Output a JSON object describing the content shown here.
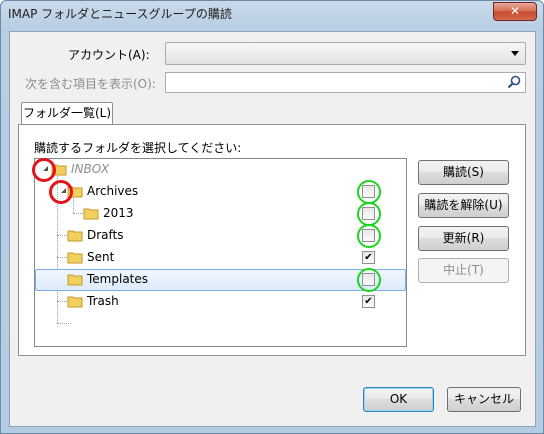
{
  "window": {
    "title": "IMAP フォルダとニュースグループの購読",
    "close_label": "✕"
  },
  "account": {
    "label": "アカウント(A):",
    "value": ""
  },
  "filter": {
    "label": "次を含む項目を表示(O):",
    "value": ""
  },
  "tabs": [
    {
      "label": "フォルダ一覧(L)"
    }
  ],
  "instruction": "購読するフォルダを選択してください:",
  "folders": [
    {
      "name": "INBOX",
      "level": 0,
      "subscribed": null,
      "disabled": true
    },
    {
      "name": "Archives",
      "level": 1,
      "subscribed": false,
      "disabled": false
    },
    {
      "name": "2013",
      "level": 2,
      "subscribed": false,
      "disabled": false
    },
    {
      "name": "Drafts",
      "level": 1,
      "subscribed": false,
      "disabled": false
    },
    {
      "name": "Sent",
      "level": 1,
      "subscribed": true,
      "disabled": false
    },
    {
      "name": "Templates",
      "level": 1,
      "subscribed": false,
      "disabled": false,
      "selected": true
    },
    {
      "name": "Trash",
      "level": 1,
      "subscribed": true,
      "disabled": false
    }
  ],
  "side_buttons": {
    "subscribe": "購読(S)",
    "unsubscribe": "購読を解除(U)",
    "refresh": "更新(R)",
    "stop": "中止(T)"
  },
  "footer": {
    "ok": "OK",
    "cancel": "キャンセル"
  },
  "check_mark": "✔",
  "colors": {
    "annotation_green": "#19d41b",
    "annotation_red": "#e2141a",
    "folder": "#f3cf5e"
  }
}
